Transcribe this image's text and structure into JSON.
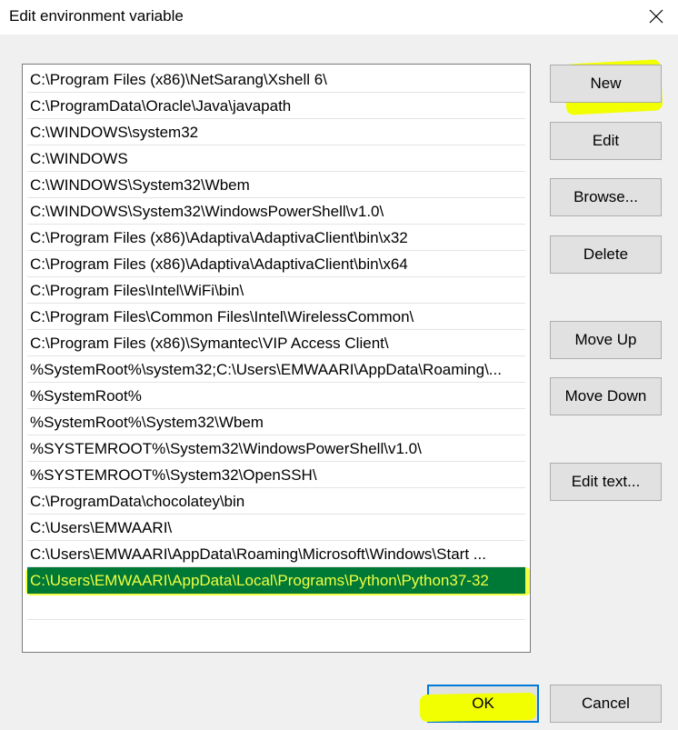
{
  "window": {
    "title": "Edit environment variable"
  },
  "icons": {
    "close": "close-icon"
  },
  "paths": [
    "C:\\Program Files (x86)\\NetSarang\\Xshell 6\\",
    "C:\\ProgramData\\Oracle\\Java\\javapath",
    "C:\\WINDOWS\\system32",
    "C:\\WINDOWS",
    "C:\\WINDOWS\\System32\\Wbem",
    "C:\\WINDOWS\\System32\\WindowsPowerShell\\v1.0\\",
    "C:\\Program Files (x86)\\Adaptiva\\AdaptivaClient\\bin\\x32",
    "C:\\Program Files (x86)\\Adaptiva\\AdaptivaClient\\bin\\x64",
    "C:\\Program Files\\Intel\\WiFi\\bin\\",
    "C:\\Program Files\\Common Files\\Intel\\WirelessCommon\\",
    "C:\\Program Files (x86)\\Symantec\\VIP Access Client\\",
    "%SystemRoot%\\system32;C:\\Users\\EMWAARI\\AppData\\Roaming\\...",
    "%SystemRoot%",
    "%SystemRoot%\\System32\\Wbem",
    "%SYSTEMROOT%\\System32\\WindowsPowerShell\\v1.0\\",
    "%SYSTEMROOT%\\System32\\OpenSSH\\",
    "C:\\ProgramData\\chocolatey\\bin",
    "C:\\Users\\EMWAARI\\",
    "C:\\Users\\EMWAARI\\AppData\\Roaming\\Microsoft\\Windows\\Start ...",
    "C:\\Users\\EMWAARI\\AppData\\Local\\Programs\\Python\\Python37-32",
    ""
  ],
  "selected_index": 19,
  "buttons": {
    "new": "New",
    "edit": "Edit",
    "browse": "Browse...",
    "delete": "Delete",
    "move_up": "Move Up",
    "move_down": "Move Down",
    "edit_text": "Edit text...",
    "ok": "OK",
    "cancel": "Cancel"
  }
}
